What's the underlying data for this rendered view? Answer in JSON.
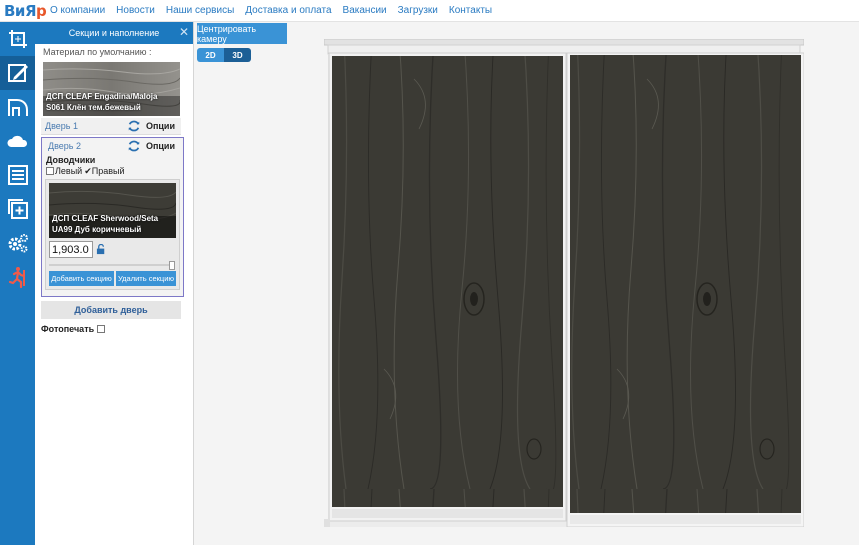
{
  "nav": {
    "logo_main": "ВиЯ",
    "logo_accent": "р",
    "links": [
      "О компании",
      "Новости",
      "Наши сервисы",
      "Доставка и оплата",
      "Вакансии",
      "Загрузки",
      "Контакты"
    ]
  },
  "toolbar": {
    "tools": [
      "crop-icon",
      "paint-brush-icon",
      "stairs-icon",
      "cloud-icon",
      "list-icon",
      "add-icon",
      "gears-icon",
      "running-person-icon"
    ],
    "active_index": 1
  },
  "panel": {
    "title": "Секции и наполнение",
    "close": "✕",
    "default_material_label": "Материал по умолчанию :",
    "default_material_name_line1": "ДСП CLEAF Engadina/Maloja",
    "default_material_name_line2": "S061 Клён тем.бежевый",
    "door1": {
      "label": "Дверь 1",
      "options": "Опции"
    },
    "door2": {
      "label": "Дверь 2",
      "options": "Опции",
      "closers_title": "Доводчики",
      "left_label": "Левый",
      "left_checked": false,
      "right_label": "Правый",
      "right_checked": true,
      "section_material_line1": "ДСП CLEAF Sherwood/Seta",
      "section_material_line2": "UA99 Дуб коричневый",
      "section_size": "1,903.0",
      "add_section": "Добавить секцию",
      "remove_section": "Удалить секцию"
    },
    "add_door": "Добавить дверь",
    "photo_print": "Фотопечать"
  },
  "viewport": {
    "center_camera": "Центрировать камеру",
    "mode_2d": "2D",
    "mode_3d": "3D",
    "active_mode": "3D"
  },
  "colors": {
    "accent": "#1c79bf",
    "dark_wood": "#3b3a34",
    "light_wood": "#8d8b86",
    "frame": "#e7e7e7"
  }
}
